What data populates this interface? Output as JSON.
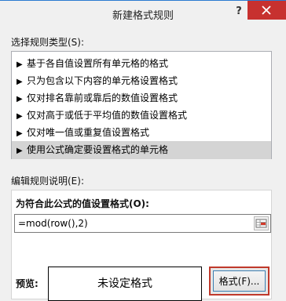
{
  "dialog": {
    "title": "新建格式规则",
    "help_glyph": "?"
  },
  "rule_types": {
    "label": "选择规则类型(S):",
    "items": [
      {
        "label": "基于各自值设置所有单元格的格式",
        "selected": false
      },
      {
        "label": "只为包含以下内容的单元格设置格式",
        "selected": false
      },
      {
        "label": "仅对排名靠前或靠后的数值设置格式",
        "selected": false
      },
      {
        "label": "仅对高于或低于平均值的数值设置格式",
        "selected": false
      },
      {
        "label": "仅对唯一值或重复值设置格式",
        "selected": false
      },
      {
        "label": "使用公式确定要设置格式的单元格",
        "selected": true
      }
    ]
  },
  "rule_description": {
    "label": "编辑规则说明(E):",
    "formula_label": "为符合此公式的值设置格式(O):",
    "formula_value": "=mod(row(),2)",
    "preview_label": "预览:",
    "preview_text": "未设定格式",
    "format_button": "格式(F)..."
  }
}
